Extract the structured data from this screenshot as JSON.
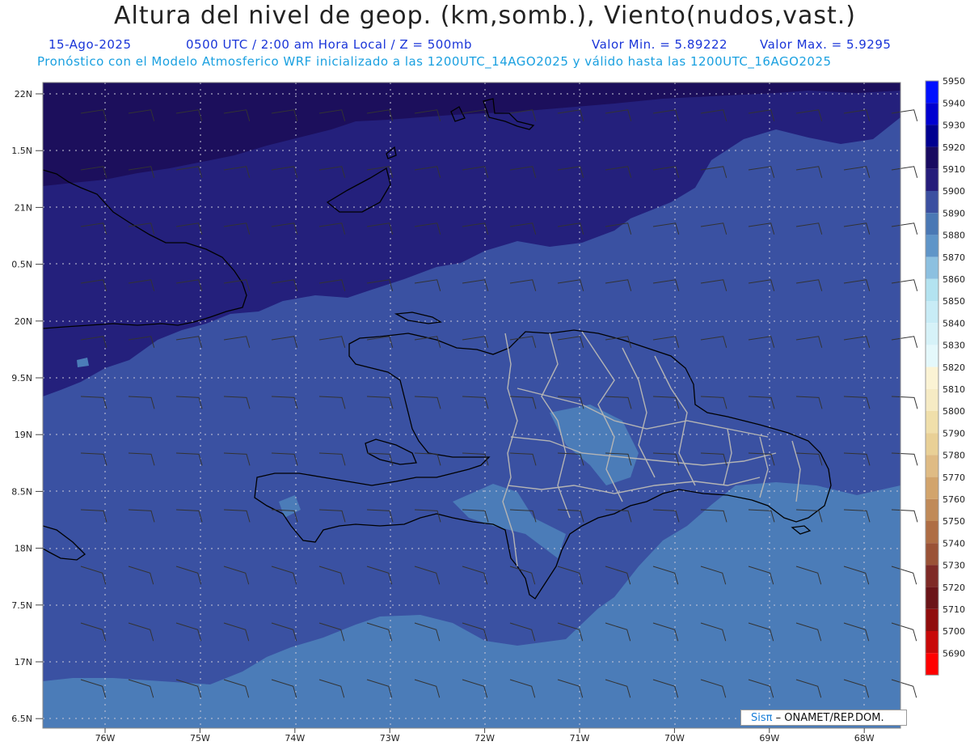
{
  "header": {
    "title": "Altura del nivel de geop. (km,somb.), Viento(nudos,vast.)",
    "date": "15-Ago-2025",
    "time": "0500 UTC / 2:00 am Hora Local / Z = 500mb",
    "valor_min": "Valor Min. = 5.89222",
    "valor_max": "Valor Max. = 5.9295",
    "forecast": "Pronóstico con el Modelo Atmosferico WRF inicializado a las 1200UTC_14AGO2025 y válido hasta las 1200UTC_16AGO2025"
  },
  "lat_labels": [
    "22N",
    "1.5N",
    "21N",
    "0.5N",
    "20N",
    "9.5N",
    "19N",
    "8.5N",
    "18N",
    "7.5N",
    "17N",
    "6.5N"
  ],
  "lon_labels": [
    "76W",
    "75W",
    "74W",
    "73W",
    "72W",
    "71W",
    "70W",
    "69W",
    "68W"
  ],
  "legend": {
    "levels": [
      "5950",
      "5940",
      "5930",
      "5920",
      "5910",
      "5900",
      "5890",
      "5880",
      "5870",
      "5860",
      "5850",
      "5840",
      "5830",
      "5820",
      "5810",
      "5800",
      "5790",
      "5780",
      "5770",
      "5760",
      "5750",
      "5740",
      "5730",
      "5720",
      "5710",
      "5700",
      "5690"
    ],
    "colors": [
      "#0010ff",
      "#0000d0",
      "#000090",
      "#180a60",
      "#251c7a",
      "#3b4fa0",
      "#4a78b4",
      "#5f95c8",
      "#8cc0e0",
      "#b3e3f0",
      "#c8ecf6",
      "#d6f2f8",
      "#e4f8fb",
      "#fbf3d4",
      "#f6ebc4",
      "#f0dfaa",
      "#e9d096",
      "#dfbb84",
      "#d2a46c",
      "#c08a58",
      "#ae6d44",
      "#9a5236",
      "#7e2a26",
      "#6a1418",
      "#900c0c",
      "#c80808",
      "#ff0000"
    ]
  },
  "colors": {
    "dark_band": "#1c0f5c",
    "band_5910": "#24207c",
    "band_5900": "#3a51a2",
    "band_5890": "#4b7cb8",
    "band_5880": "#5d97c9"
  },
  "credit": {
    "logo": "Sisπ",
    "text": "– ONAMET/REP.DOM."
  }
}
